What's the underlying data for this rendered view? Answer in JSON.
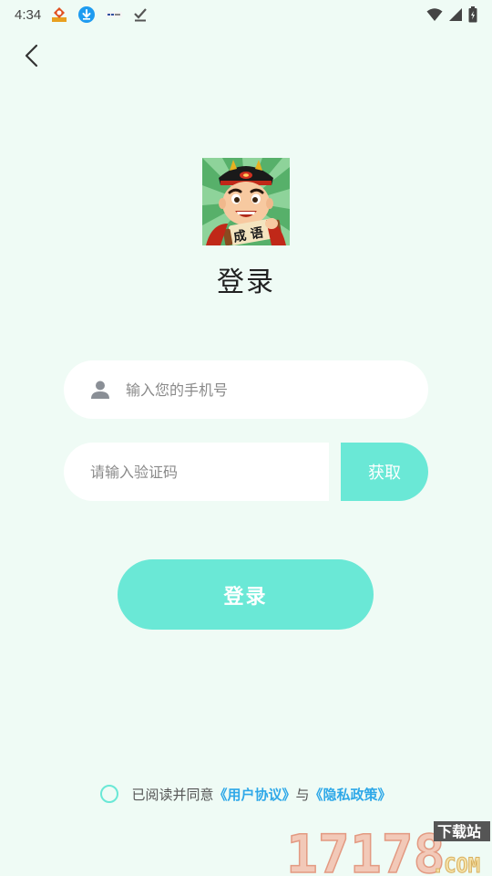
{
  "status_bar": {
    "time": "4:34",
    "icons": [
      "app-notification-icon",
      "download-icon",
      "news-icon",
      "check-icon"
    ],
    "right_icons": [
      "wifi-icon",
      "signal-icon",
      "battery-icon"
    ]
  },
  "header": {
    "back_icon": "chevron-left-icon"
  },
  "logo": {
    "badge_text": "成 语"
  },
  "title": "登录",
  "phone": {
    "placeholder": "输入您的手机号",
    "value": "",
    "icon": "user-icon"
  },
  "code": {
    "placeholder": "请输入验证码",
    "value": ""
  },
  "get_code_label": "获取",
  "login_label": "登录",
  "agreement": {
    "prefix": "已阅读并同意",
    "user_agreement": "《用户协议》",
    "conjunction": "与",
    "privacy_policy": "《隐私政策》",
    "checked": false
  },
  "watermark": {
    "number": "17178",
    "suffix": ".COM",
    "tag": "下载站"
  },
  "colors": {
    "background": "#EFFBF5",
    "accent": "#6AE8D6",
    "link": "#2EA8E8"
  }
}
